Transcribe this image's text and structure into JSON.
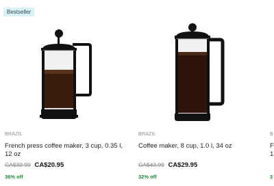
{
  "products": [
    {
      "badge": "Bestseller",
      "image_icon": "french-press-icon",
      "brand": "BRAZIL",
      "title": "French press coffee maker, 3 cup, 0.35 l, 12 oz",
      "old_price": "CA$32.99",
      "new_price": "CA$20.95",
      "discount": "36% off"
    },
    {
      "image_icon": "french-press-icon",
      "brand": "BRAZIL",
      "title": "Coffee maker, 8 cup, 1.0 l, 34 oz",
      "old_price": "CA$43.99",
      "new_price": "CA$29.95",
      "discount": "32% off"
    },
    {
      "brand": "B",
      "title": "F\n1",
      "discount": "3"
    }
  ],
  "colors": {
    "badge_bg": "#d9f1f7",
    "discount": "#1f8a3a",
    "coffee": "#3a1c0d"
  }
}
